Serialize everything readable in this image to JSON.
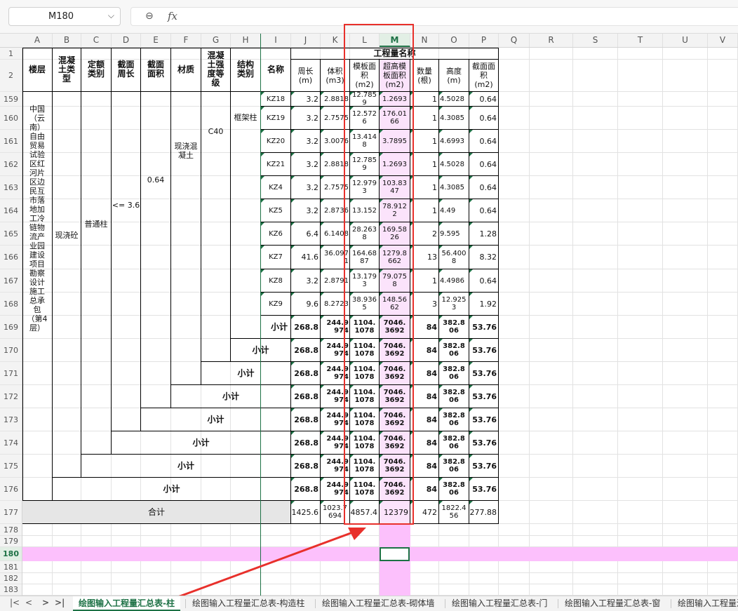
{
  "formula_bar": {
    "name_box": "M180",
    "zoom_icon": "magnifier-icon",
    "fx_label": "fx"
  },
  "columns": [
    "A",
    "B",
    "C",
    "D",
    "E",
    "F",
    "G",
    "H",
    "I",
    "J",
    "K",
    "L",
    "M",
    "N",
    "O",
    "P",
    "Q",
    "R",
    "S",
    "T",
    "U",
    "V"
  ],
  "rows": [
    "1",
    "2",
    "159",
    "160",
    "161",
    "162",
    "163",
    "164",
    "165",
    "166",
    "167",
    "168",
    "169",
    "170",
    "171",
    "172",
    "173",
    "174",
    "175",
    "176",
    "177",
    "178",
    "179",
    "180",
    "181",
    "182",
    "183"
  ],
  "headers": {
    "floor": "楼层",
    "conc_type": "混凝土类型",
    "quota": "定额类别",
    "perimeter": "截面周长",
    "area": "截面面积",
    "material": "材质",
    "grade": "混凝土强度等级",
    "struct": "结构类别",
    "name": "名称",
    "group": "工程量名称",
    "zc": "周长(m)",
    "tj": "体积(m3)",
    "mb": "模板面积(m2)",
    "cg": "超高模板面积(m2)",
    "sl": "数量(根)",
    "gd": "高度(m)",
    "jm": "截面面积(m2)"
  },
  "merged": {
    "floor": "中国（云南）自由贸易试验区红河片区边民互市落地加工冷链物流产业园建设项目勘察设计施工总承包（第4层）",
    "conc_type": "现浇砼",
    "quota": "普通柱",
    "perimeter": "<= 3.6",
    "area": "0.64",
    "material": "现浇混凝土",
    "grade": "C40",
    "struct": "框架柱"
  },
  "data_rows": [
    {
      "name": "KZ18",
      "zc": "3.2",
      "tj": "2.8818",
      "mb": "12.785 9",
      "cg": "1.2693",
      "sl": "1",
      "gd": "4.5028",
      "jm": "0.64"
    },
    {
      "name": "KZ19",
      "zc": "3.2",
      "tj": "2.7575",
      "mb": "12.572 6",
      "cg": "176.01 66",
      "sl": "1",
      "gd": "4.3085",
      "jm": "0.64"
    },
    {
      "name": "KZ20",
      "zc": "3.2",
      "tj": "3.0076",
      "mb": "13.414 8",
      "cg": "3.7895",
      "sl": "1",
      "gd": "4.6993",
      "jm": "0.64"
    },
    {
      "name": "KZ21",
      "zc": "3.2",
      "tj": "2.8818",
      "mb": "12.785 9",
      "cg": "1.2693",
      "sl": "1",
      "gd": "4.5028",
      "jm": "0.64"
    },
    {
      "name": "KZ4",
      "zc": "3.2",
      "tj": "2.7575",
      "mb": "12.979 3",
      "cg": "103.83 47",
      "sl": "1",
      "gd": "4.3085",
      "jm": "0.64"
    },
    {
      "name": "KZ5",
      "zc": "3.2",
      "tj": "2.8736",
      "mb": "13.152",
      "cg": "78.912 2",
      "sl": "1",
      "gd": "4.49",
      "jm": "0.64"
    },
    {
      "name": "KZ6",
      "zc": "6.4",
      "tj": "6.1408",
      "mb": "28.263 8",
      "cg": "169.58 26",
      "sl": "2",
      "gd": "9.595",
      "jm": "1.28"
    },
    {
      "name": "KZ7",
      "zc": "41.6",
      "tj": "36.097 1",
      "mb": "164.68 87",
      "cg": "1279.8 662",
      "sl": "13",
      "gd": "56.400 8",
      "jm": "8.32"
    },
    {
      "name": "KZ8",
      "zc": "3.2",
      "tj": "2.8791",
      "mb": "13.179 3",
      "cg": "79.075 8",
      "sl": "1",
      "gd": "4.4986",
      "jm": "0.64"
    },
    {
      "name": "KZ9",
      "zc": "9.6",
      "tj": "8.2723",
      "mb": "38.936 5",
      "cg": "148.56 62",
      "sl": "3",
      "gd": "12.925 3",
      "jm": "1.92"
    }
  ],
  "subtotal": {
    "label": "小计",
    "zc": "268.8",
    "tj": "244.9 974",
    "mb": "1104. 1078",
    "cg": "7046. 3692",
    "sl": "84",
    "gd": "382.8 06",
    "jm": "53.76"
  },
  "total": {
    "label": "合计",
    "zc": "1425.6",
    "tj": "1023.7 694",
    "mb": "4857.4",
    "cg": "12379",
    "sl": "472",
    "gd": "1822.4 56",
    "jm": "277.88"
  },
  "sheet_tabs": [
    "绘图输入工程量汇总表-柱",
    "绘图输入工程量汇总表-构造柱",
    "绘图输入工程量汇总表-砌体墙",
    "绘图输入工程量汇总表-门",
    "绘图输入工程量汇总表-窗",
    "绘图输入工程量汇"
  ],
  "colors": {
    "accent": "#1d7145",
    "highlight": "#fcc0fc",
    "annotation": "#e8302b"
  }
}
